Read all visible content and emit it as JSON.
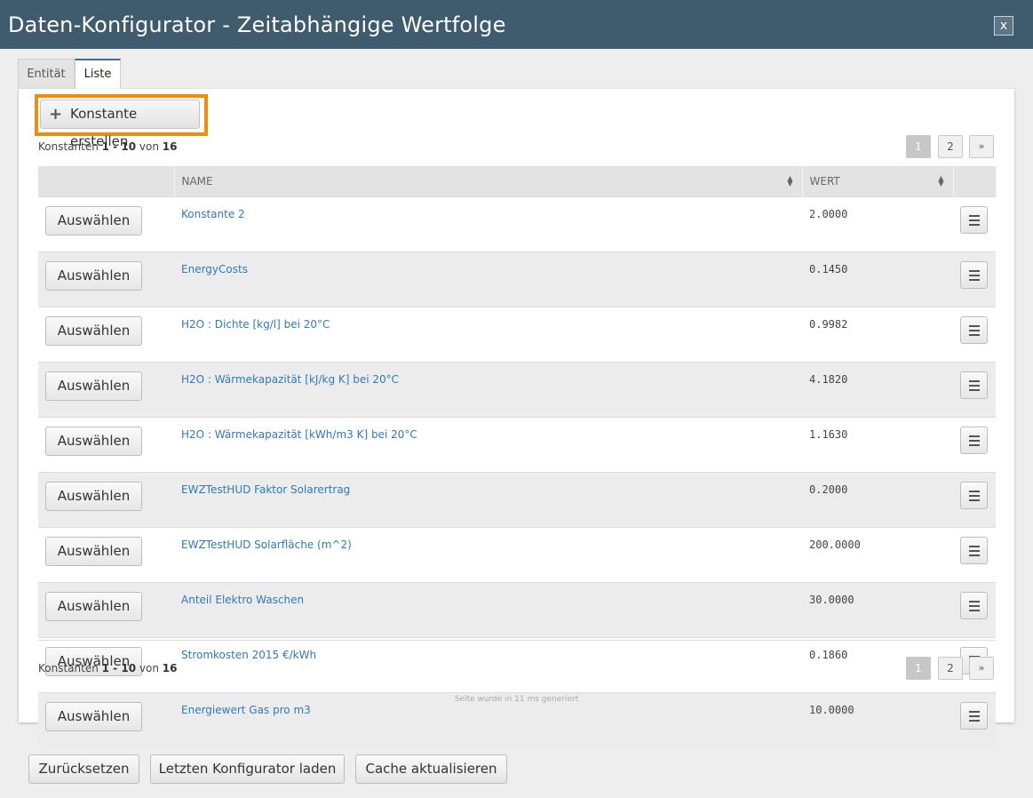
{
  "dialog": {
    "title": "Daten-Konfigurator - Zeitabhängige Wertfolge",
    "close_label": "x"
  },
  "tabs": [
    {
      "label": "Entität"
    },
    {
      "label": "Liste"
    }
  ],
  "toolbar": {
    "create_label": "Konstante erstellen",
    "create_icon": "plus-icon",
    "highlight_color": "#f58a0c"
  },
  "summary": {
    "prefix": "Konstanten",
    "range": "1 - 10",
    "of": "von",
    "total": "16"
  },
  "pagination": {
    "pages": [
      "1",
      "2"
    ],
    "next": "»",
    "current": "1"
  },
  "table": {
    "headers": {
      "name": "NAME",
      "value": "WERT"
    },
    "select_label": "Auswählen",
    "row_menu_icon": "menu-icon",
    "rows": [
      {
        "name": "Konstante 2",
        "value": "2.0000"
      },
      {
        "name": "EnergyCosts",
        "value": "0.1450"
      },
      {
        "name": "H2O : Dichte [kg/l] bei 20°C",
        "value": "0.9982"
      },
      {
        "name": "H2O : Wärmekapazität [kJ/kg K] bei 20°C",
        "value": "4.1820"
      },
      {
        "name": "H2O : Wärmekapazität [kWh/m3 K] bei 20°C",
        "value": "1.1630"
      },
      {
        "name": "EWZTestHUD Faktor Solarertrag",
        "value": "0.2000"
      },
      {
        "name": "EWZTestHUD Solarfläche (m^2)",
        "value": "200.0000"
      },
      {
        "name": "Anteil Elektro Waschen",
        "value": "30.0000"
      },
      {
        "name": "Stromkosten 2015 €/kWh",
        "value": "0.1860"
      },
      {
        "name": "Energiewert Gas pro m3",
        "value": "10.0000"
      }
    ]
  },
  "footnote": "Seite wurde in 11 ms generiert",
  "footer": {
    "reset_label": "Zurücksetzen",
    "load_label": "Letzten Konfigurator laden",
    "cache_label": "Cache aktualisieren"
  },
  "colors": {
    "titlebar": "#3f5b6e",
    "link": "#2f7ab8",
    "accent": "#3b6f94"
  }
}
